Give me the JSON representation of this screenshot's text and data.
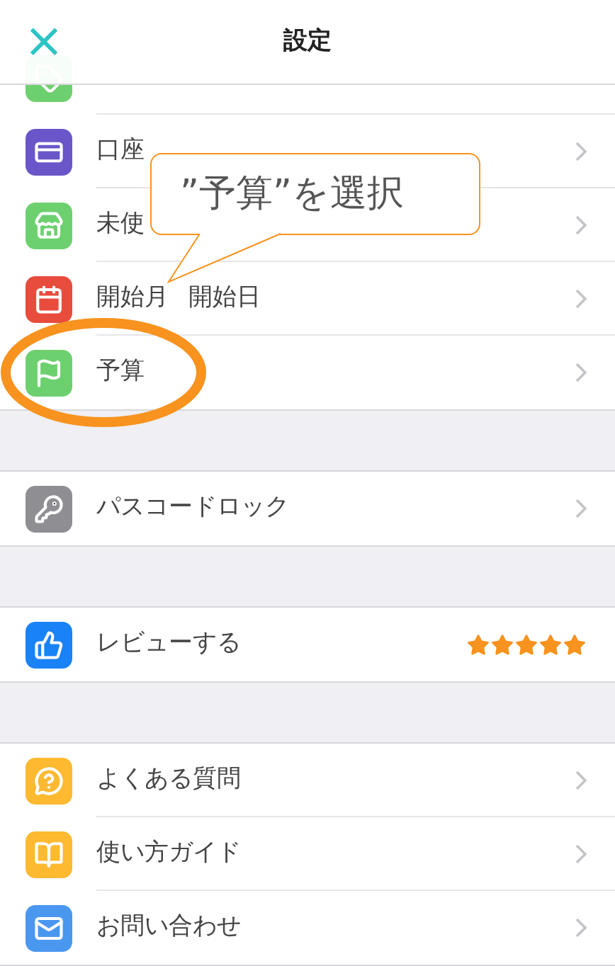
{
  "header": {
    "close": "×",
    "title": "設定"
  },
  "sections": [
    {
      "items": [
        {
          "kind": "link",
          "color": "#6dd06f"
        },
        {
          "kind": "link",
          "color": "#6a56c8",
          "label": "口座"
        },
        {
          "kind": "link",
          "color": "#6dd06f",
          "label": "未使"
        },
        {
          "kind": "link",
          "color": "#e84c3d",
          "label": "開始月",
          "label_2": "開始日"
        },
        {
          "kind": "link",
          "color": "#6dd06f",
          "label": "予算"
        }
      ]
    },
    {
      "items": [
        {
          "kind": "link",
          "color": "#8e8e93",
          "label": "パスコードロック"
        }
      ]
    },
    {
      "items": [
        {
          "kind": "rating",
          "color": "#1a82f7",
          "label": "レビューする",
          "stars": 5
        }
      ]
    },
    {
      "items": [
        {
          "kind": "link",
          "color": "#fdb930",
          "label": "よくある質問"
        },
        {
          "kind": "link",
          "color": "#fdb930",
          "label": "使い方ガイド"
        },
        {
          "kind": "link",
          "color": "#4a97f0",
          "label": "お問い合わせ"
        }
      ]
    }
  ],
  "callout": {
    "text": "”予算”を選択"
  }
}
